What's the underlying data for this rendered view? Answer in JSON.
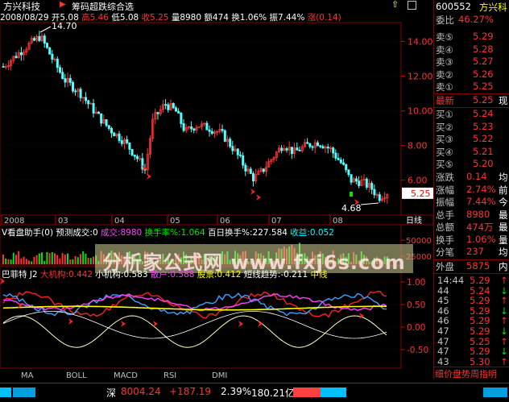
{
  "header": {
    "stock_name": "方兴科技",
    "indicator_name": "筹码超跌综合选",
    "date": "2008/08/29",
    "open_label": "开",
    "open": "5.08",
    "high_label": "高",
    "high": "5.46",
    "low_label": "低",
    "low": "5.08",
    "close_label": "收",
    "close": "5.25",
    "volume_label": "量",
    "volume": "8980",
    "amount_label": "额",
    "amount": "474",
    "turnover_label": "换",
    "turnover": "1.06%",
    "amplitude_label": "振",
    "amplitude": "7.44%",
    "change_label": "涨",
    "change": "(0.14)"
  },
  "price_axis": {
    "labels": [
      "14.00",
      "12.00",
      "10.00",
      "8.00",
      "6.00"
    ],
    "current": "5.25",
    "max_marker": "14.70",
    "min_marker": "4.68"
  },
  "date_axis": [
    "2008",
    "03",
    "04",
    "05",
    "06",
    "07",
    "08"
  ],
  "date_axis_right": "日线",
  "volume_panel": {
    "title": "V看盘助手(0)",
    "predict": "预测成交:0",
    "volume": "成交:8980",
    "turnover": "换手率%:1.064",
    "avg_turnover": "百日换手%:227.584",
    "profit": "收益:0.052",
    "axis": [
      "50000",
      "25000"
    ]
  },
  "indicator_panel": {
    "title": "巴菲特 J2",
    "big": "大机构:0.442",
    "small": "小机构:0.583",
    "retail": "散户:0.588",
    "stock": "股票:0.412",
    "trend": "短线趋势:-0.211",
    "mid": "中线",
    "axis": [
      "1.00",
      "0.50",
      "0.00",
      "-0.50"
    ]
  },
  "watermark": "分析家公式网  www.fxj6s.com",
  "tabs": [
    "MA",
    "BOLL",
    "MACD",
    "RSI",
    "DMI"
  ],
  "right_panel": {
    "code": "600552",
    "name": "方兴科",
    "commission_ratio_label": "委比",
    "commission_ratio": "46.27%",
    "sells": [
      [
        "卖⑤",
        "5.29"
      ],
      [
        "卖④",
        "5.28"
      ],
      [
        "卖③",
        "5.27"
      ],
      [
        "卖②",
        "5.26"
      ],
      [
        "卖①",
        "5.25"
      ]
    ],
    "last_label": "最新",
    "last": "5.25",
    "last_extra": "现",
    "buys": [
      [
        "买①",
        "5.24"
      ],
      [
        "买②",
        "5.23"
      ],
      [
        "买③",
        "5.22"
      ],
      [
        "买④",
        "5.21"
      ],
      [
        "买⑤",
        "5.20"
      ]
    ],
    "stats": [
      [
        "涨跌",
        "0.14",
        "均"
      ],
      [
        "涨幅",
        "2.74%",
        "前"
      ],
      [
        "振幅",
        "7.44%",
        "今"
      ],
      [
        "总手",
        "8980",
        "最"
      ],
      [
        "总额",
        "474万",
        "最"
      ],
      [
        "换手",
        "1.06%",
        "量"
      ],
      [
        "分笔",
        "237",
        "均"
      ]
    ],
    "outer_label": "外盘",
    "outer": "5875",
    "inner_label": "内",
    "ticks": [
      [
        "14:44",
        "5.29"
      ],
      [
        "44",
        "5.24"
      ],
      [
        "45",
        "5.29"
      ],
      [
        "46",
        "5.29"
      ],
      [
        "46",
        "5.29"
      ],
      [
        "47",
        "5.29"
      ],
      [
        "47",
        "5.25"
      ],
      [
        "47",
        "5.29"
      ],
      [
        "43",
        "5.30"
      ]
    ],
    "footer": "细价盘势周指明"
  },
  "status": {
    "market": "深",
    "index": "8004.24",
    "change": "+187.19",
    "pct": "2.39%",
    "amount": "180.21亿"
  },
  "colors": {
    "up": "#ff3232",
    "down": "#00ffff",
    "grid": "#800000",
    "panel_border": "#c00000"
  }
}
